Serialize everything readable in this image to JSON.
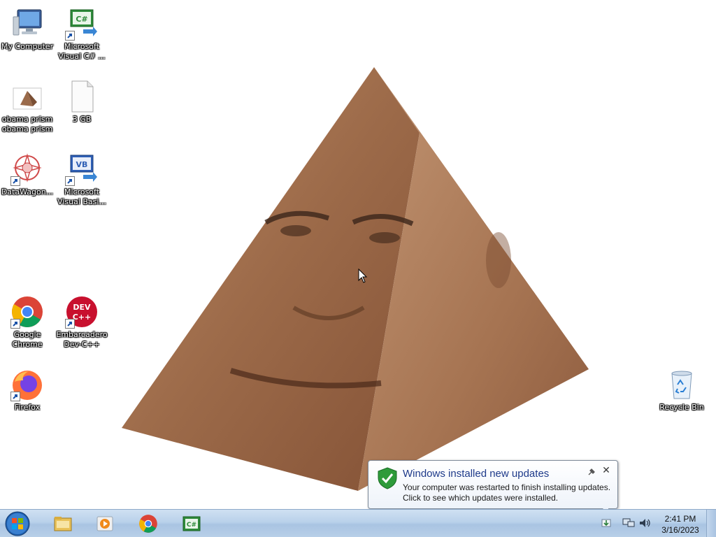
{
  "desktop": {
    "icons": [
      {
        "label": "My Computer",
        "icon": "computer-icon"
      },
      {
        "label": "Microsoft\nVisual C# ...",
        "icon": "csharp-icon"
      },
      {
        "label": "obama prism\nobama prism",
        "icon": "pyramid-image-icon"
      },
      {
        "label": "3 GB",
        "icon": "blank-file-icon"
      },
      {
        "label": "DataWagon...",
        "icon": "datawagon-icon"
      },
      {
        "label": "Microsoft\nVisual Basi...",
        "icon": "vb-icon"
      },
      {
        "label": "Google\nChrome",
        "icon": "chrome-icon"
      },
      {
        "label": "Embarcadero\nDev-C++",
        "icon": "devcpp-icon"
      },
      {
        "label": "Firefox",
        "icon": "firefox-icon"
      },
      {
        "label": "Recycle Bin",
        "icon": "recycle-bin-icon"
      }
    ],
    "wallpaper_image": "obama-prism"
  },
  "notification": {
    "title": "Windows installed new updates",
    "line1": "Your computer was restarted to finish installing updates.",
    "line2": "Click to see which updates were installed.",
    "close_symbol": "✕"
  },
  "taskbar": {
    "pinned": [
      "explorer-icon",
      "media-player-icon",
      "chrome-icon",
      "csharp-icon"
    ],
    "clock_time": "2:41 PM",
    "clock_date": "3/16/2023"
  },
  "colors": {
    "balloon_title": "#1e3a8a",
    "taskbar_top": "#cfe0f2",
    "taskbar_bottom": "#a9c4e2"
  }
}
